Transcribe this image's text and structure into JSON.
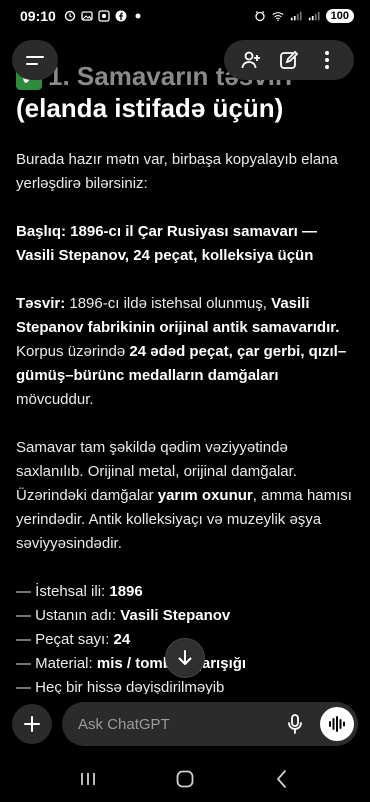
{
  "status_bar": {
    "time": "09:10",
    "battery": "100",
    "left_icons": [
      "alarm-icon",
      "photos-icon",
      "screenshot-icon",
      "facebook-icon",
      "dot-icon"
    ],
    "right_icons": [
      "alarm-clock-icon",
      "wifi-icon",
      "signal-icon",
      "signal-icon",
      "battery-icon"
    ]
  },
  "heading": {
    "line1": "1. Samavarın təsviri",
    "line2": "(elanda istifadə üçün)"
  },
  "intro": "Burada hazır mətn var, birbaşa kopyalayıb elana yerləşdirə bilərsiniz:",
  "title_para": "Başlıq: 1896-cı il Çar Rusiyası samavarı — Vasili Stepanov, 24 peçat, kolleksiya üçün",
  "desc": {
    "label": "Təsvir:",
    "t1": " 1896-cı ildə istehsal olunmuş, ",
    "b1": "Vasili Stepanov fabrikinin orijinal antik samavarıdır.",
    "t2": " Korpus üzərində ",
    "b2": "24 ədəd peçat, çar gerbi, qızıl–gümüş–bürünc medalların damğaları",
    "t3": " mövcuddur."
  },
  "condition": {
    "t1": "Samavar tam şəkildə qədim vəziyyətində saxlanılıb. Orijinal metal, orijinal damğalar. Üzərindəki damğalar ",
    "b1": "yarım oxunur",
    "t2": ", amma hamısı yerindədir. Antik kolleksiyaçı və muzeylik əşya səviyyəsindədir."
  },
  "list": [
    {
      "prefix": "— İstehsal ili: ",
      "value": "1896"
    },
    {
      "prefix": "— Ustanın adı: ",
      "value": "Vasili Stepanov"
    },
    {
      "prefix": "— Peçat sayı: ",
      "value": "24"
    },
    {
      "prefix": "— Material: ",
      "value": "mis / tombak qarışığı"
    },
    {
      "prefix": "— Heç bir hissə dəyişdirilməyib",
      "value": ""
    }
  ],
  "input": {
    "placeholder": "Ask ChatGPT"
  },
  "colors": {
    "background": "#000000",
    "surface": "#2b2b2b",
    "check": "#2e8b3e"
  }
}
